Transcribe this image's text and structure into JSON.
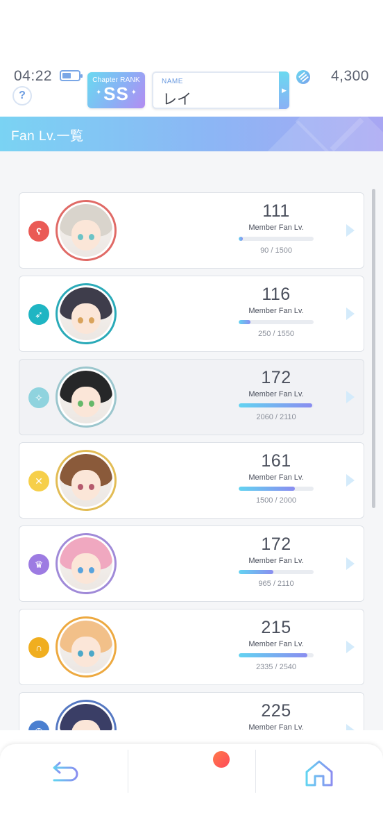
{
  "status": {
    "time": "04:22",
    "battery_level": 0.55
  },
  "header": {
    "help_label": "?",
    "rank_title": "Chapter RANK",
    "rank_value": "SS",
    "name_label": "NAME",
    "name_value": "レイ",
    "currency_icon": "jewel-icon",
    "currency_value": "4,300"
  },
  "page_title": "Fan Lv.一覧",
  "fan_label": "Member Fan Lv.",
  "members": [
    {
      "level": "111",
      "progress": "90 / 1500",
      "fill": 0.06,
      "attr_icon": "bear-icon",
      "attr_color": "#ea5a55",
      "ring_color": "#e06a66",
      "hair_color": "#d9d4cc",
      "eye_color": "#6cc3c6"
    },
    {
      "level": "116",
      "progress": "250 / 1550",
      "fill": 0.16,
      "attr_icon": "rocket-icon",
      "attr_color": "#1fb5c3",
      "ring_color": "#2aaab8",
      "hair_color": "#3e3d4b",
      "eye_color": "#d9a35c"
    },
    {
      "level": "172",
      "progress": "2060 / 2110",
      "fill": 0.98,
      "attr_icon": "crane-icon",
      "attr_color": "#8fd3de",
      "ring_color": "#9bc6cd",
      "hair_color": "#262728",
      "eye_color": "#66b86a"
    },
    {
      "level": "161",
      "progress": "1500 / 2000",
      "fill": 0.75,
      "attr_icon": "tools-icon",
      "attr_color": "#f6cf4a",
      "ring_color": "#e2bc55",
      "hair_color": "#8a5a3a",
      "eye_color": "#b55a6d"
    },
    {
      "level": "172",
      "progress": "965 / 2110",
      "fill": 0.46,
      "attr_icon": "trophy-icon",
      "attr_color": "#9d7be2",
      "ring_color": "#a08ad8",
      "hair_color": "#f0a8c0",
      "eye_color": "#58a3dd"
    },
    {
      "level": "215",
      "progress": "2335 / 2540",
      "fill": 0.92,
      "attr_icon": "rabbit-icon",
      "attr_color": "#f0ae1f",
      "ring_color": "#eda940",
      "hair_color": "#f2c089",
      "eye_color": "#4da8c8"
    },
    {
      "level": "225",
      "progress": "",
      "fill": 0,
      "attr_icon": "clock-icon",
      "attr_color": "#4a7fd0",
      "ring_color": "#5578c2",
      "hair_color": "#3a3e66",
      "eye_color": "#7a5ab0"
    }
  ],
  "nav": [
    {
      "name": "back-icon"
    },
    {
      "name": "menu-icon",
      "has_notification": true
    },
    {
      "name": "home-icon"
    }
  ]
}
